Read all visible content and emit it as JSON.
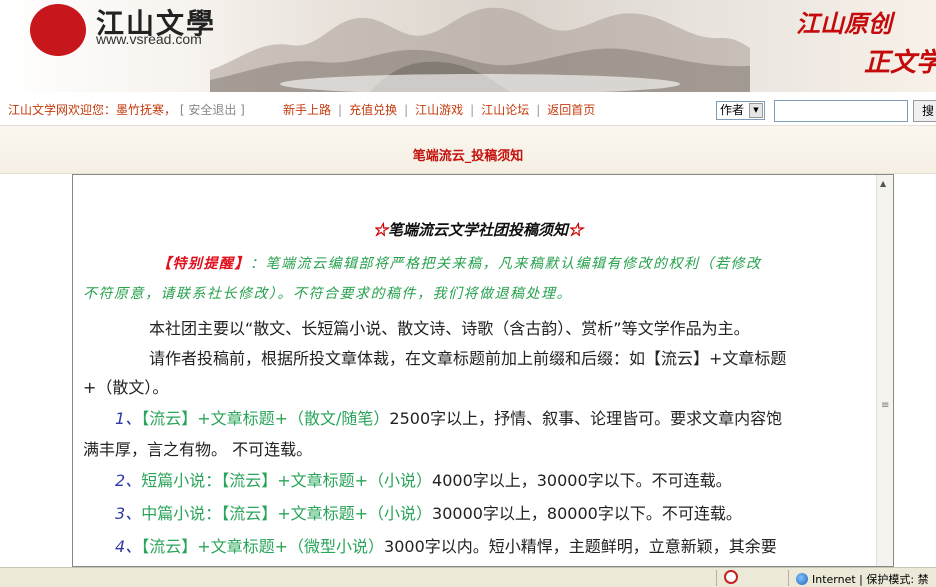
{
  "header": {
    "logo_text": "江山文學",
    "logo_url": "www.vsread.com",
    "slogan_line1": "江山原创",
    "slogan_line2": "正文学"
  },
  "nav": {
    "welcome": "江山文学网欢迎您：墨竹抚寒，",
    "logout": "[ 安全退出 ]",
    "links": [
      "新手上路",
      "充值兑换",
      "江山游戏",
      "江山论坛",
      "返回首页"
    ],
    "search_field": "作者",
    "search_value": "",
    "search_button": "搜"
  },
  "page": {
    "title": "笔端流云_投稿须知"
  },
  "article": {
    "heading": "笔端流云文学社团投稿须知",
    "star": "☆",
    "notice_tag": "【特别提醒】",
    "notice_line1": "：笔端流云编辑部将严格把关来稿，凡来稿默认编辑有修改的权利（若修改",
    "notice_line2": "不符原意，请联系社长修改）。不符合要求的稿件，我们将做退稿处理。",
    "p1": "本社团主要以“散文、长短篇小说、散文诗、诗歌（含古韵）、赏析”等文学作品为主。",
    "p2_line1": "请作者投稿前，根据所投文章体裁，在文章标题前加上前缀和后缀：如【流云】+文章标题",
    "p2_line2": "+（散文）。",
    "items": [
      {
        "num": "1",
        "sep": "、",
        "fmt": "【流云】+文章标题+（散文/随笔）",
        "desc": "2500字以上，抒情、叙事、论理皆可。要求文章内容饱",
        "desc2": "满丰厚，言之有物。 不可连载。"
      },
      {
        "num": "2",
        "sep": "、",
        "fmt": "短篇小说：【流云】+文章标题+（小说）",
        "desc": "4000字以上，30000字以下。不可连载。"
      },
      {
        "num": "3",
        "sep": "、",
        "fmt": "中篇小说：【流云】+文章标题+（小说）",
        "desc": "30000字以上，80000字以下。不可连载。"
      },
      {
        "num": "4",
        "sep": "、",
        "fmt": "【流云】+文章标题+（微型小说）",
        "desc": "3000字以内。短小精悍，主题鲜明，立意新颖，其余要"
      }
    ]
  },
  "statusbar": {
    "zone": "Internet | 保护模式: 禁"
  },
  "colors": {
    "accent_red": "#c4120d",
    "nav_text": "#c43a0c",
    "notice_green": "#27a14e",
    "format_green": "#2aa45a",
    "number_blue": "#2d3aa8"
  }
}
